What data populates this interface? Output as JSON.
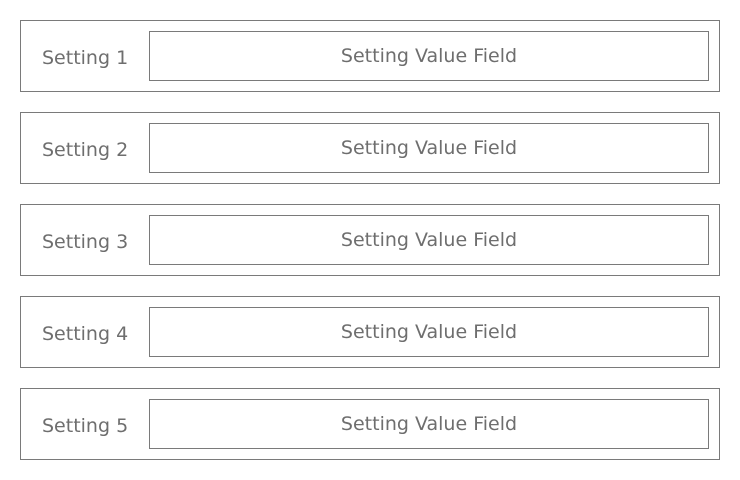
{
  "settings": [
    {
      "label": "Setting 1",
      "value": "Setting Value Field"
    },
    {
      "label": "Setting 2",
      "value": "Setting Value Field"
    },
    {
      "label": "Setting 3",
      "value": "Setting Value Field"
    },
    {
      "label": "Setting 4",
      "value": "Setting Value Field"
    },
    {
      "label": "Setting 5",
      "value": "Setting Value Field"
    }
  ],
  "colors": {
    "border": "#7a7a7a",
    "text": "#6e6e6e",
    "background": "#ffffff"
  }
}
